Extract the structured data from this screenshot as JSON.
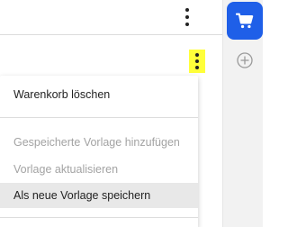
{
  "header": {
    "more_icon": "more-vertical-icon"
  },
  "row": {
    "more_icon": "more-vertical-icon",
    "highlight_color": "#ffff3a"
  },
  "sidebar": {
    "cart_icon": "shopping-cart-icon",
    "cart_color": "#1f5fe8",
    "add_icon": "add-circle-icon"
  },
  "menu": {
    "items": [
      {
        "label": "Warenkorb löschen",
        "enabled": true
      },
      {
        "label": "Gespeicherte Vorlage hinzufügen",
        "enabled": false
      },
      {
        "label": "Vorlage aktualisieren",
        "enabled": false
      },
      {
        "label": "Als neue Vorlage speichern",
        "enabled": true,
        "hovered": true
      }
    ]
  }
}
